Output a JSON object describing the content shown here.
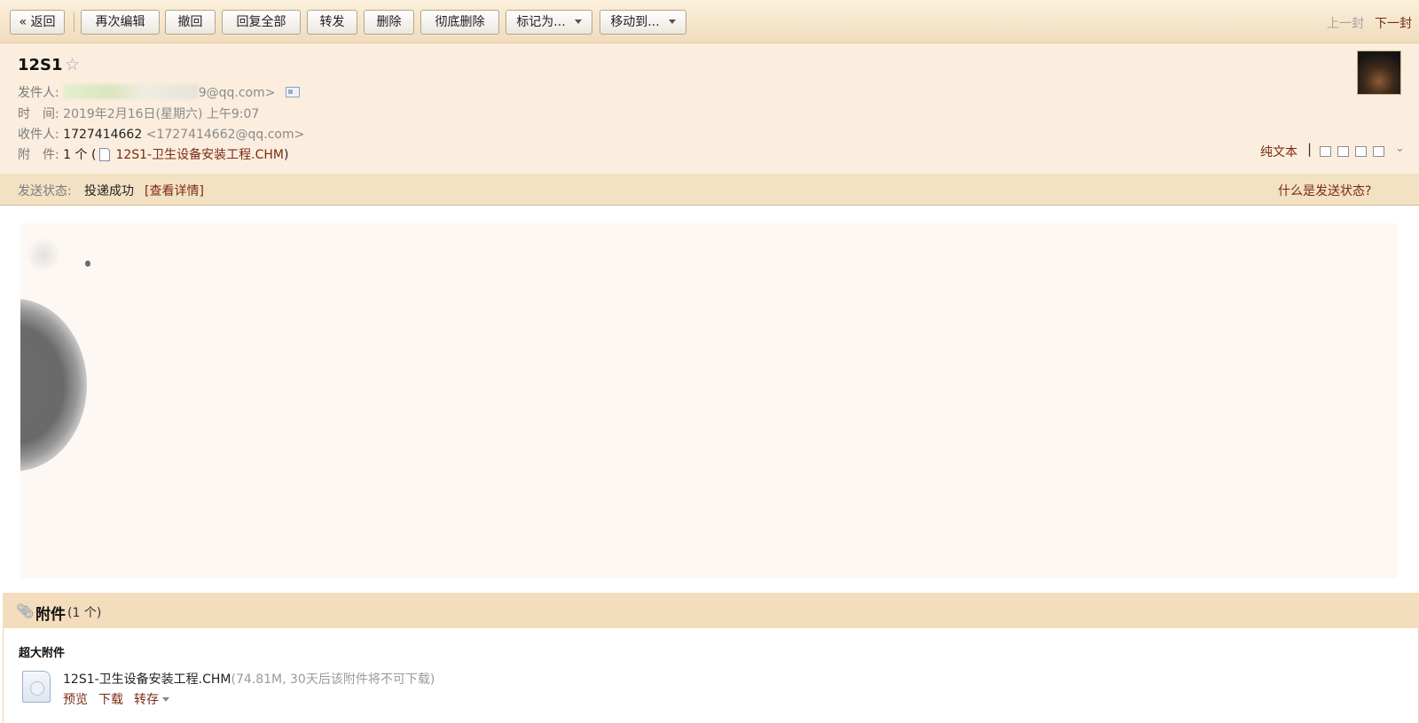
{
  "toolbar": {
    "back": "« 返回",
    "reedit": "再次编辑",
    "recall": "撤回",
    "reply_all": "回复全部",
    "forward": "转发",
    "delete": "删除",
    "delete_permanently": "彻底删除",
    "mark_as": "标记为...",
    "move_to": "移动到...",
    "prev": "上一封",
    "next": "下一封"
  },
  "email": {
    "subject": "12S1",
    "from_label": "发件人:",
    "from_value": "9@qq.com>",
    "time_label": "时　间:",
    "time_value": "2019年2月16日(星期六) 上午9:07",
    "to_label": "收件人:",
    "to_name": "1727414662",
    "to_address": "<1727414662@qq.com>",
    "attach_label": "附　件:",
    "attach_count": "1 个 (",
    "attach_file": "12S1-卫生设备安装工程.CHM",
    "attach_close": ")",
    "plain_text": "纯文本",
    "pipe": "|"
  },
  "status": {
    "label": "发送状态:",
    "value": "投递成功",
    "detail_link": "[查看详情]",
    "help_link": "什么是发送状态?"
  },
  "attachments": {
    "title": "附件",
    "count": "(1 个)",
    "section_title": "超大附件",
    "file_name": "12S1-卫生设备安装工程.CHM",
    "file_meta": "(74.81M, 30天后该附件将不可下载)",
    "preview": "预览",
    "download": "下载",
    "save": "转存"
  },
  "colors": {
    "toolbar_bg": "#f0dcbd",
    "header_bg": "#fbeede",
    "link": "#7a2a14"
  }
}
